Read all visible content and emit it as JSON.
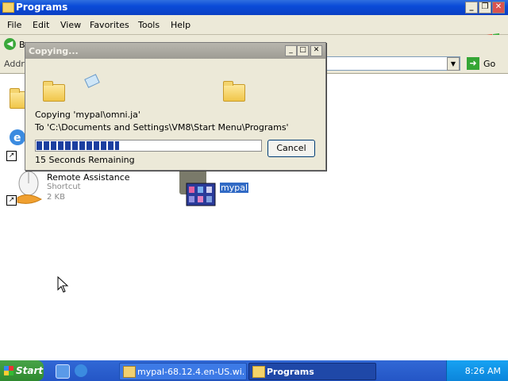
{
  "window": {
    "title": "Programs",
    "menu": [
      "File",
      "Edit",
      "View",
      "Favorites",
      "Tools",
      "Help"
    ],
    "back_label": "Ba",
    "address_label": "Addre",
    "go_label": "Go"
  },
  "items": [
    {
      "name": "Remote Assistance",
      "type": "Shortcut",
      "size": "2 KB"
    },
    {
      "name": "mypal"
    }
  ],
  "dialog": {
    "title": "Copying...",
    "file_line": "Copying 'mypal\\omni.ja'",
    "to_line": "To 'C:\\Documents and Settings\\VM8\\Start Menu\\Programs'",
    "progress": 0.37,
    "remaining": "15 Seconds Remaining",
    "cancel_label": "Cancel"
  },
  "taskbar": {
    "start_label": "Start",
    "tasks": [
      {
        "label": "mypal-68.12.4.en-US.wi..."
      },
      {
        "label": "Programs",
        "active": true
      }
    ],
    "clock": "8:26 AM"
  }
}
